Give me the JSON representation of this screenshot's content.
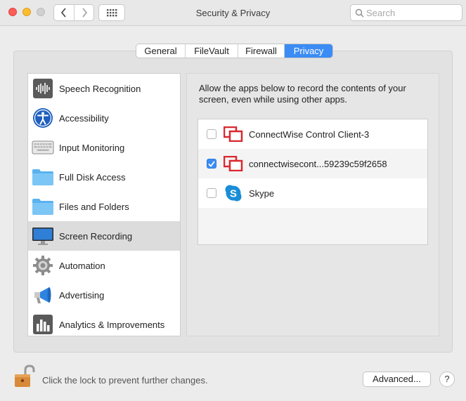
{
  "window": {
    "title": "Security & Privacy",
    "search_placeholder": "Search"
  },
  "tabs": [
    {
      "label": "General",
      "active": false
    },
    {
      "label": "FileVault",
      "active": false
    },
    {
      "label": "Firewall",
      "active": false
    },
    {
      "label": "Privacy",
      "active": true
    }
  ],
  "sidebar": {
    "items": [
      {
        "label": "Speech Recognition",
        "icon": "speech-recognition-icon"
      },
      {
        "label": "Accessibility",
        "icon": "accessibility-icon"
      },
      {
        "label": "Input Monitoring",
        "icon": "keyboard-icon"
      },
      {
        "label": "Full Disk Access",
        "icon": "folder-icon"
      },
      {
        "label": "Files and Folders",
        "icon": "folder-icon"
      },
      {
        "label": "Screen Recording",
        "icon": "display-icon",
        "selected": true
      },
      {
        "label": "Automation",
        "icon": "gear-icon"
      },
      {
        "label": "Advertising",
        "icon": "megaphone-icon"
      },
      {
        "label": "Analytics & Improvements",
        "icon": "bar-chart-icon"
      }
    ]
  },
  "main": {
    "description": "Allow the apps below to record the contents of your screen, even while using other apps.",
    "apps": [
      {
        "name": "ConnectWise Control Client-3",
        "checked": false,
        "icon": "connectwise-icon"
      },
      {
        "name": "connectwisecont...59239c59f2658",
        "checked": true,
        "icon": "connectwise-icon"
      },
      {
        "name": "Skype",
        "checked": false,
        "icon": "skype-icon"
      }
    ]
  },
  "footer": {
    "lock_message": "Click the lock to prevent further changes.",
    "advanced_label": "Advanced...",
    "help_label": "?"
  },
  "colors": {
    "accent": "#3b8cf4",
    "connectwise": "#d9282f",
    "skype": "#1a8dd8"
  }
}
